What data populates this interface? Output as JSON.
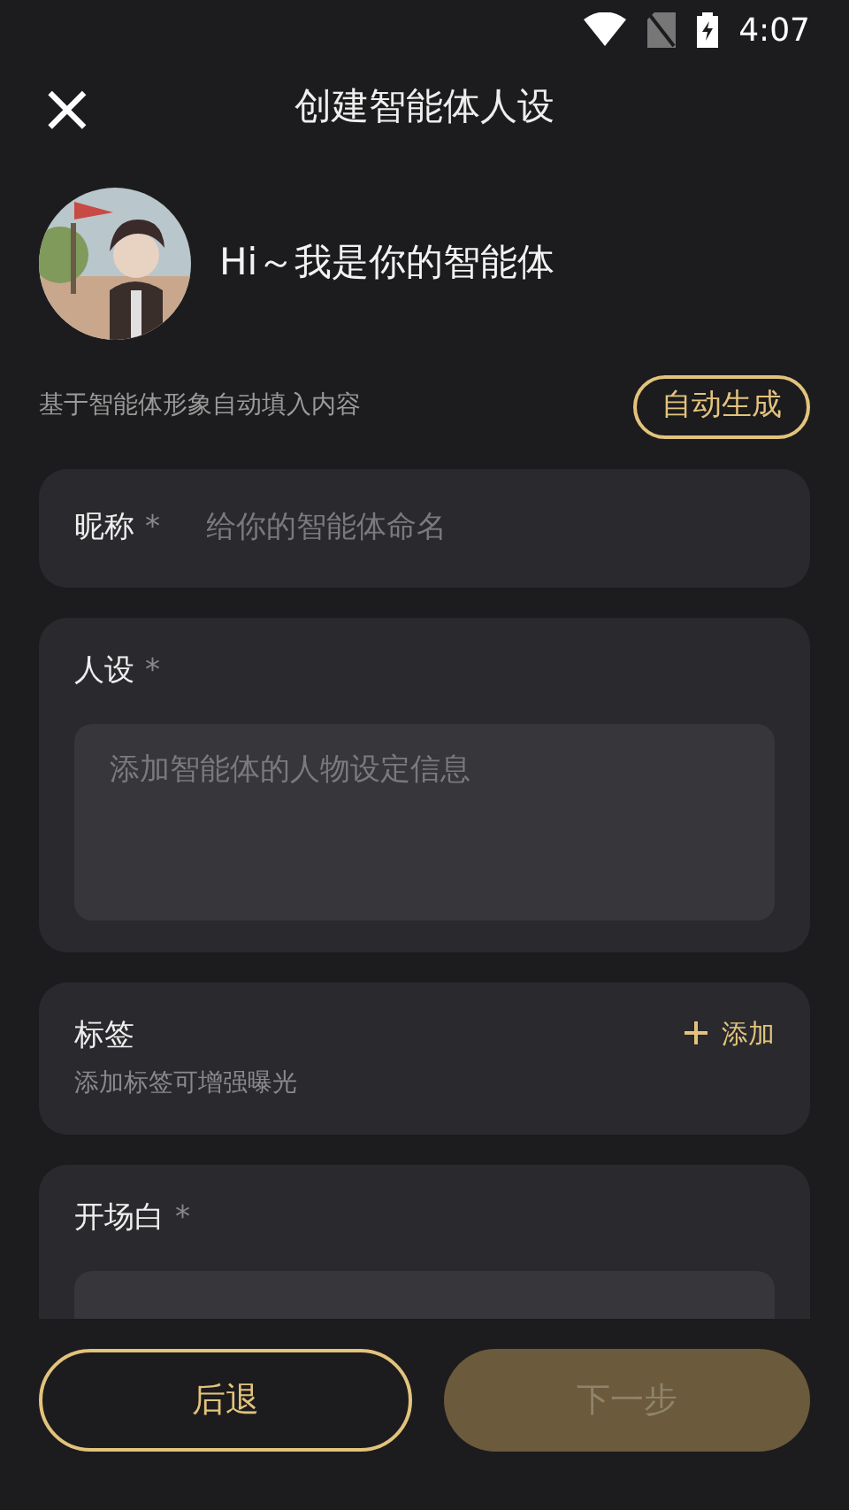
{
  "status_bar": {
    "time": "4:07"
  },
  "header": {
    "close": "×",
    "title": "创建智能体人设"
  },
  "profile": {
    "greeting": "Hi～我是你的智能体"
  },
  "auto_fill": {
    "hint": "基于智能体形象自动填入内容",
    "button": "自动生成"
  },
  "fields": [
    {
      "kind": "inline",
      "label": "昵称",
      "required_mark": "*",
      "placeholder": "给你的智能体命名"
    },
    {
      "kind": "textarea",
      "label": "人设",
      "required_mark": "*",
      "placeholder": "添加智能体的人物设定信息"
    },
    {
      "kind": "tags",
      "label": "标签",
      "sublabel": "添加标签可增强曝光",
      "action": "添加"
    },
    {
      "kind": "textarea",
      "label": "开场白",
      "required_mark": "*"
    }
  ],
  "buttons": [
    {
      "label": "后退",
      "disabled": false,
      "kind": "outline"
    },
    {
      "label": "下一步",
      "disabled": true,
      "kind": "filled"
    }
  ]
}
